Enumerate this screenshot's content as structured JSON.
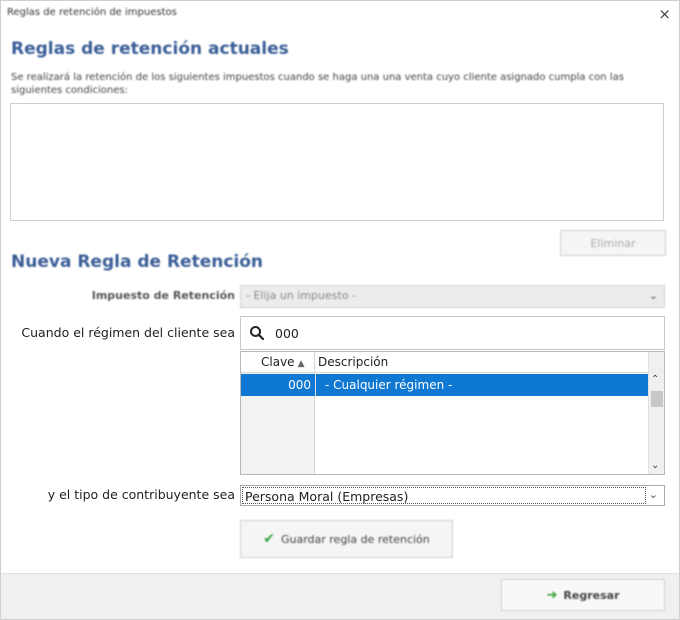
{
  "window": {
    "title": "Reglas de retención de impuestos",
    "close_glyph": "×"
  },
  "current_rules": {
    "heading": "Reglas de retención actuales",
    "description": "Se realizará la retención de los siguientes impuestos cuando se haga una una venta cuyo cliente asignado cumpla con las siguientes condiciones:",
    "delete_button": "Eliminar"
  },
  "new_rule": {
    "heading": "Nueva Regla de Retención",
    "tax_label": "Impuesto de Retención",
    "tax_placeholder": "- Elija un impuesto -",
    "regimen_label": "Cuando el régimen del cliente sea",
    "search_value": "000",
    "grid": {
      "columns": [
        "Clave",
        "Descripción"
      ],
      "rows": [
        {
          "clave": "000",
          "descripcion": " - Cualquier régimen -"
        }
      ]
    },
    "taxpayer_label": "y el tipo de contribuyente sea",
    "taxpayer_value": "Persona Moral (Empresas)",
    "save_button": "Guardar regla de retención"
  },
  "footer": {
    "back_button": "Regresar"
  },
  "icons": {
    "search": "search-icon",
    "check": "check-icon",
    "back": "arrow-icon",
    "sort": "sort-asc-icon",
    "chevron": "chevron-down-icon"
  },
  "colors": {
    "heading": "#3a5e97",
    "selection": "#0f78d2",
    "check": "#3aa13a"
  }
}
